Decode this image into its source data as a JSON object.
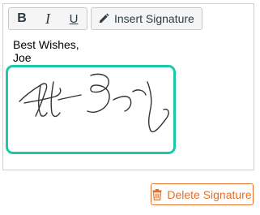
{
  "toolbar": {
    "bold_label": "B",
    "italic_label": "I",
    "underline_label": "U",
    "insert_signature_label": "Insert Signature",
    "insert_signature_icon": "pencil-icon"
  },
  "editor": {
    "closing_line": "Best Wishes,",
    "name_line": "Joe",
    "signature_image": "handwritten-signature"
  },
  "actions": {
    "delete_signature_label": "Delete Signature",
    "delete_signature_icon": "trash-icon"
  },
  "colors": {
    "signature_border": "#1dc8a8",
    "delete_accent": "#e0712c",
    "toolbar_text": "#2d3b45"
  }
}
